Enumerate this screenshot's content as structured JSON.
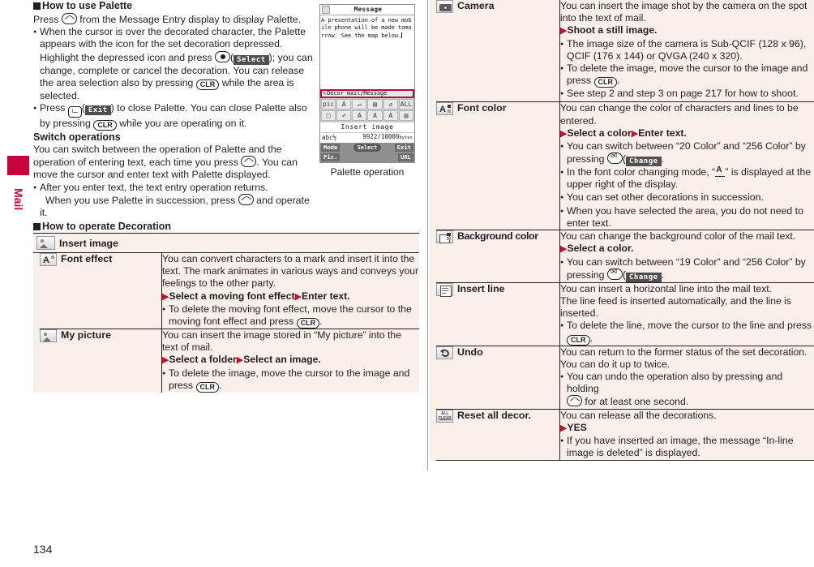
{
  "page": {
    "number": "134",
    "side_tab_label": "Mail"
  },
  "left": {
    "heading1": "How to use Palette",
    "intro": {
      "pre": "Press",
      "key": "call-key",
      "post": "from the Message Entry display to display Palette."
    },
    "bullets": [
      {
        "lines": [
          "When the cursor is over the decorated character, the Palette",
          "appears with the icon for the set decoration depressed.",
          "Highlight the depressed icon and press",
          "you can change, complete or cancel the decoration. You can",
          "release the area selection also by pressing",
          "area is selected."
        ],
        "softkey": "Select",
        "clr_key": "CLR"
      },
      {
        "lines": [
          "Press",
          "also by pressing"
        ],
        "softkey": "Exit",
        "func_key": "i-mode",
        "clr_key": "CLR",
        "tail1": ") to close Palette. You can close Palette",
        "tail2": "while you are operating on it."
      }
    ],
    "subhead1": "Switch operations",
    "switch_text": [
      "You can switch between the operation of Palette and the",
      "operation of entering text, each time you press",
      "move the cursor and enter text with Palette displayed."
    ],
    "switch_tail": ". You can",
    "bullet_after": {
      "line1": "After you enter text, the text entry operation returns.",
      "line2a": "When you use Palette in succession, press",
      "line2b": "and operate it."
    },
    "heading2": "How to operate Decoration"
  },
  "phone": {
    "title_bar": "Message",
    "body_text": "A presentation of a new mobile phone will be made tomorrow. See the map below.",
    "status_bar": "Decor mail/Message",
    "palette_row1": [
      "pic",
      "A",
      "↵",
      "▤",
      "↺",
      "ALL"
    ],
    "palette_row2": [
      "□",
      "✐",
      "A",
      "A",
      "A",
      "▤"
    ],
    "label": "Insert image",
    "counter_left": "abc½",
    "counter_right": "9922/10000",
    "counter_unit": "bytes",
    "soft_left_top": "Mode",
    "soft_left_bottom": "Pic.",
    "soft_center": "Select",
    "soft_right_top": "Exit",
    "soft_right_bottom": "URL",
    "caption": "Palette operation"
  },
  "table_left": {
    "header": {
      "icon": "insert-image-icon",
      "label": "Insert image"
    },
    "rows": [
      {
        "icon": "font-effect-icon",
        "label": "Font effect",
        "paragraphs": [
          "You can convert characters to a mark and insert it into the text. The mark animates in various ways and conveys your feelings to the other party."
        ],
        "step": {
          "a1": "Select a moving font effect",
          "a2": "Enter text."
        },
        "notes": [
          {
            "text_before": "To delete the moving font effect, move the cursor to the moving font effect and press",
            "key": "CLR",
            "text_after": "."
          }
        ]
      },
      {
        "icon": "my-picture-icon",
        "label": "My picture",
        "paragraphs": [
          "You can insert the image stored in “My picture” into the text of mail."
        ],
        "step": {
          "a1": "Select a folder",
          "a2": "Select an image."
        },
        "notes": [
          {
            "text_before": "To delete the image, move the cursor to the image and press",
            "key": "CLR",
            "text_after": "."
          }
        ]
      }
    ]
  },
  "table_right": {
    "rows": [
      {
        "icon": "camera-icon",
        "label": "Camera",
        "paragraphs": [
          "You can insert the image shot by the camera on the spot into the text of mail."
        ],
        "step": {
          "a1": "Shoot a still image.",
          "a2": ""
        },
        "notes": [
          {
            "text_before": "The image size of the camera is Sub-QCIF (128 x 96), QCIF (176 x 144) or QVGA (240 x 320).",
            "key": "",
            "text_after": ""
          },
          {
            "text_before": "To delete the image, move the cursor to the image and press",
            "key": "CLR",
            "text_after": "."
          },
          {
            "text_before": "See step 2 and step 3 on page 217 for how to shoot.",
            "key": "",
            "text_after": ""
          }
        ]
      },
      {
        "icon": "font-color-icon",
        "label": "Font color",
        "paragraphs": [
          "You can change the color of characters and lines to be entered."
        ],
        "step": {
          "a1": "Select a color",
          "a2": "Enter text."
        },
        "notes": [
          {
            "text_before": "You can switch between “20 Color” and “256 Color” by pressing",
            "key": "MAIL",
            "softkey": "Change",
            "text_after": "."
          },
          {
            "text_before": "In the font color changing mode, “",
            "key": "A-UNDERLINE",
            "text_after": "” is displayed at the upper right of the display."
          },
          {
            "text_before": "You can set other decorations in succession.",
            "key": "",
            "text_after": ""
          },
          {
            "text_before": "When you have selected the area, you do not need to enter text.",
            "key": "",
            "text_after": ""
          }
        ]
      },
      {
        "icon": "background-color-icon",
        "label": "Background color",
        "paragraphs": [
          "You can change the background color of the mail text."
        ],
        "step": {
          "a1": "Select a color.",
          "a2": ""
        },
        "notes": [
          {
            "text_before": "You can switch between “19 Color” and “256 Color” by pressing",
            "key": "MAIL",
            "softkey": "Change",
            "text_after": "."
          }
        ]
      },
      {
        "icon": "insert-line-icon",
        "label": "Insert line",
        "paragraphs": [
          "You can insert a horizontal line into the mail text.",
          "The line feed is inserted automatically, and the line is inserted."
        ],
        "step": {
          "a1": "",
          "a2": ""
        },
        "notes": [
          {
            "text_before": "To delete the line, move the cursor to the line and press",
            "key": "CLR",
            "text_after": "."
          }
        ]
      },
      {
        "icon": "undo-icon",
        "label": "Undo",
        "paragraphs": [
          "You can return to the former status of the set decoration. You can do it up to twice."
        ],
        "step": {
          "a1": "",
          "a2": ""
        },
        "notes": [
          {
            "text_before": "You can undo the operation also by pressing and holding",
            "key": "CALL",
            "text_after": "for at least one second."
          }
        ]
      },
      {
        "icon": "reset-all-decor-icon",
        "label": "Reset all decor.",
        "paragraphs": [
          "You can release all the decorations."
        ],
        "step": {
          "a1": "YES",
          "a2": ""
        },
        "notes": [
          {
            "text_before": "If you have inserted an image, the message “In-line image is deleted” is displayed.",
            "key": "",
            "text_after": ""
          }
        ]
      }
    ]
  },
  "colors": {
    "tab_red": "#c8023c",
    "arrow_red": "#cf0a2c",
    "table_bg": "#f9efeb",
    "ink": "#231f20"
  }
}
